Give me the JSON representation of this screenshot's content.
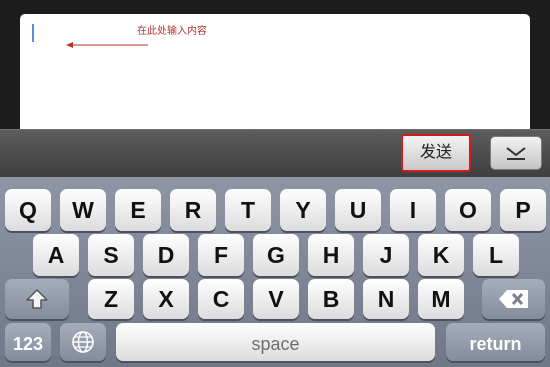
{
  "editor": {
    "hint": "在此处输入内容"
  },
  "toolbar": {
    "send_label": "发送",
    "dismiss_icon": "chevron-down-icon"
  },
  "keyboard": {
    "row1": [
      "Q",
      "W",
      "E",
      "R",
      "T",
      "Y",
      "U",
      "I",
      "O",
      "P"
    ],
    "row2": [
      "A",
      "S",
      "D",
      "F",
      "G",
      "H",
      "J",
      "K",
      "L"
    ],
    "row3": [
      "Z",
      "X",
      "C",
      "V",
      "B",
      "N",
      "M"
    ],
    "shift_icon": "shift-icon",
    "delete_icon": "backspace-icon",
    "numbers_label": "123",
    "globe_icon": "globe-icon",
    "space_label": "space",
    "return_label": "return"
  },
  "colors": {
    "hint_text": "#b8322c",
    "send_border": "#d41a1a",
    "keyboard_bg": "#7f8797"
  }
}
